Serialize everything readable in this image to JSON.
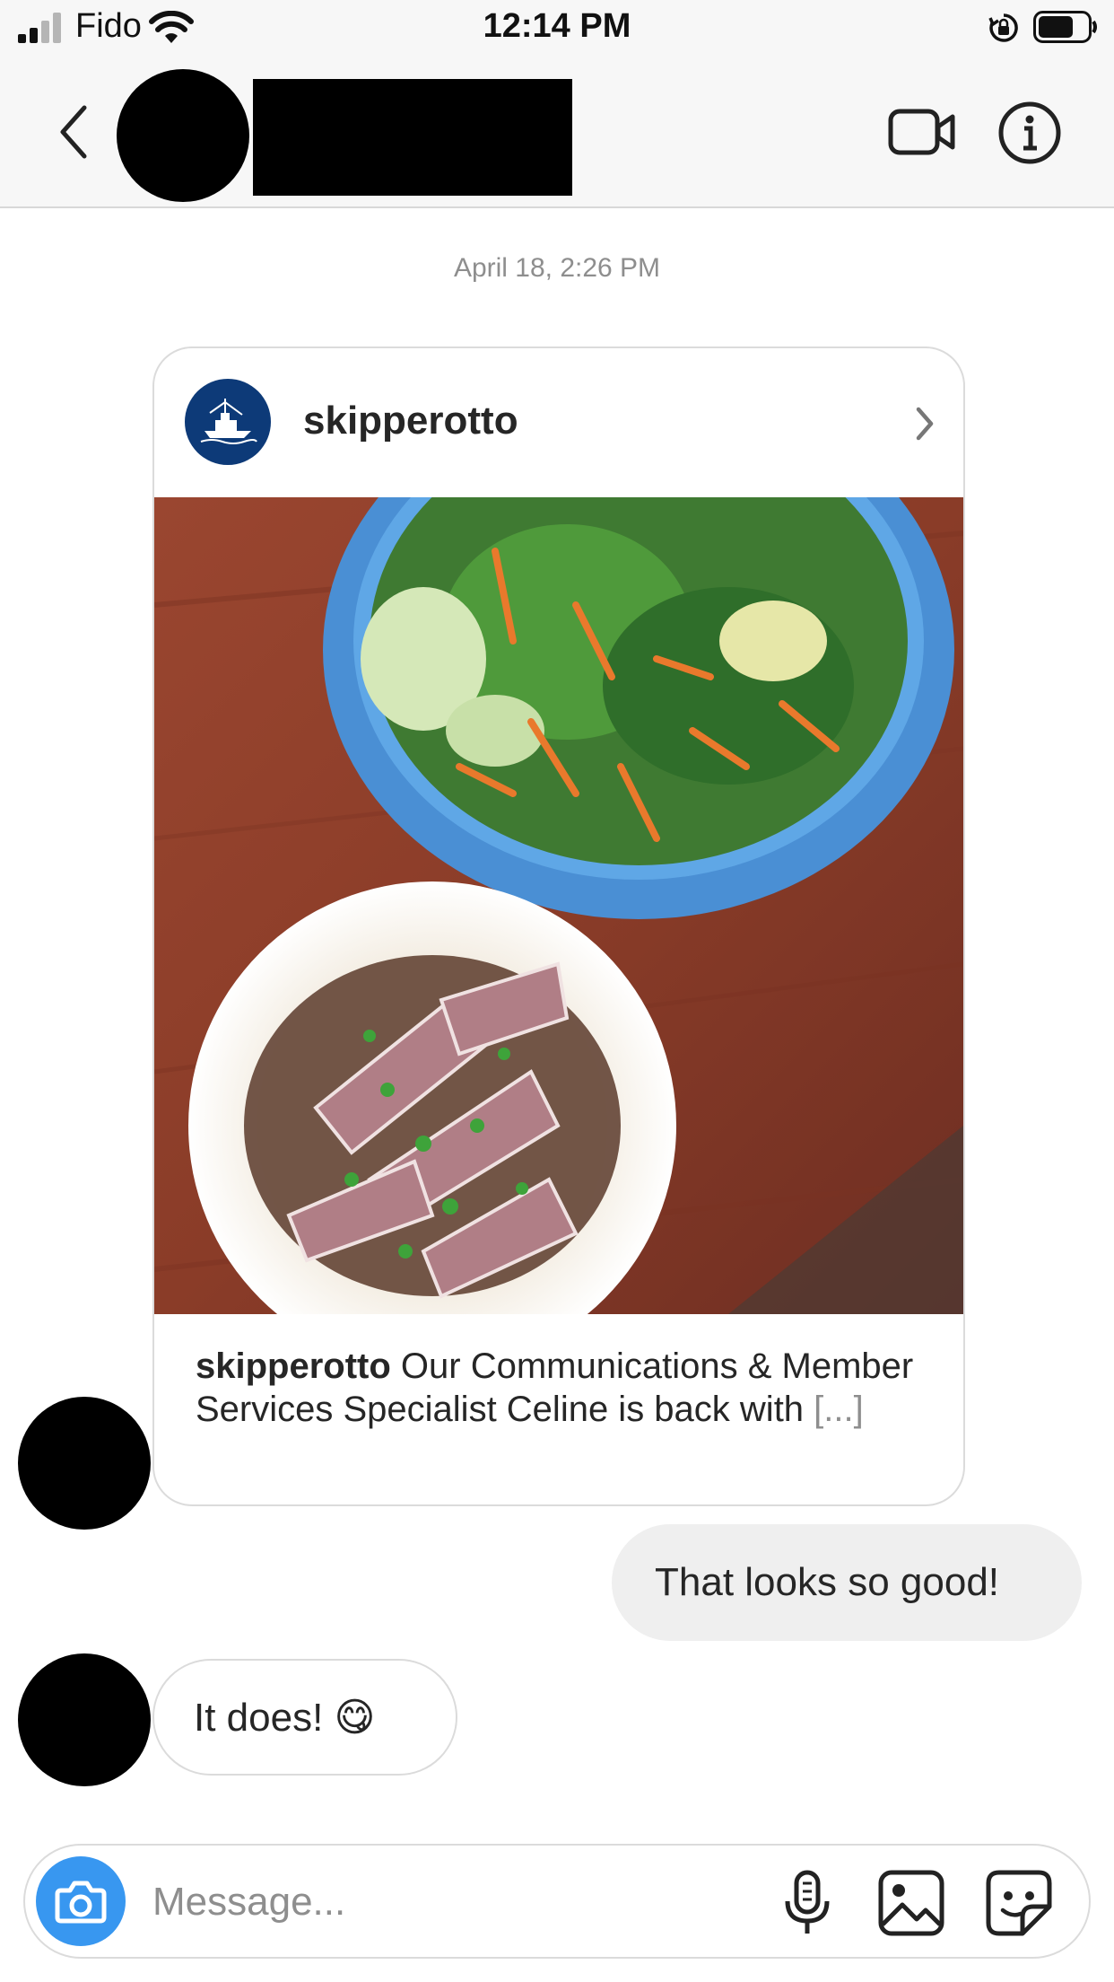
{
  "status_bar": {
    "carrier": "Fido",
    "time": "12:14 PM",
    "signal_bars_filled": 2,
    "signal_bars_total": 4,
    "battery_level": 0.7
  },
  "header": {
    "back_icon": "chevron-left-icon",
    "video_icon": "video-camera-icon",
    "info_icon": "info-icon"
  },
  "thread": {
    "timestamp": "April 18, 2:26 PM",
    "shared_post": {
      "username": "skipperotto",
      "caption_user": "skipperotto",
      "caption_text": " Our Communications & Member Services Specialist Celine is back with ",
      "caption_more": "[...]"
    },
    "messages": [
      {
        "direction": "outgoing",
        "text": "That looks so good!"
      },
      {
        "direction": "incoming",
        "text": "It does! ",
        "emoji": "😋"
      }
    ]
  },
  "composer": {
    "placeholder": "Message...",
    "camera_icon": "camera-icon",
    "mic_icon": "microphone-icon",
    "gallery_icon": "image-icon",
    "sticker_icon": "sticker-icon"
  },
  "colors": {
    "camera_button": "#3897f0",
    "avatar_blue": "#0d3a78",
    "muted_text": "#8e8e8e",
    "outgoing_bubble": "#efefef"
  }
}
